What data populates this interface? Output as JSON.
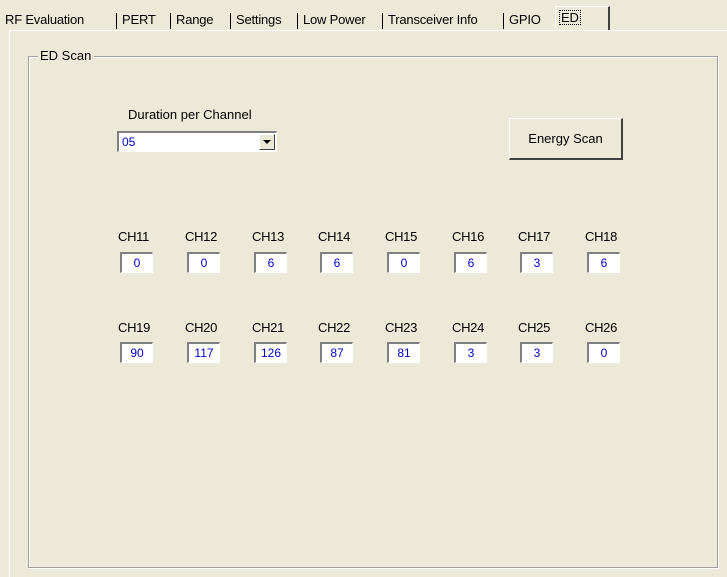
{
  "tabs": [
    {
      "label": "RF Evaluation"
    },
    {
      "label": "PERT"
    },
    {
      "label": "Range"
    },
    {
      "label": "Settings"
    },
    {
      "label": "Low Power"
    },
    {
      "label": "Transceiver Info"
    },
    {
      "label": "GPIO"
    },
    {
      "label": "ED",
      "selected": true
    }
  ],
  "ed_scan": {
    "group_title": "ED Scan",
    "duration_label": "Duration per Channel",
    "duration_value": "05",
    "scan_button": "Energy Scan",
    "channels": [
      {
        "label": "CH11",
        "value": "0"
      },
      {
        "label": "CH12",
        "value": "0"
      },
      {
        "label": "CH13",
        "value": "6"
      },
      {
        "label": "CH14",
        "value": "6"
      },
      {
        "label": "CH15",
        "value": "0"
      },
      {
        "label": "CH16",
        "value": "6"
      },
      {
        "label": "CH17",
        "value": "3"
      },
      {
        "label": "CH18",
        "value": "6"
      },
      {
        "label": "CH19",
        "value": "90"
      },
      {
        "label": "CH20",
        "value": "117"
      },
      {
        "label": "CH21",
        "value": "126"
      },
      {
        "label": "CH22",
        "value": "87"
      },
      {
        "label": "CH23",
        "value": "81"
      },
      {
        "label": "CH24",
        "value": "3"
      },
      {
        "label": "CH25",
        "value": "3"
      },
      {
        "label": "CH26",
        "value": "0"
      }
    ]
  },
  "colors": {
    "background": "#ece9d8",
    "value_text": "#0000cc"
  },
  "icons": {
    "dropdown": "chevron-down-icon"
  }
}
